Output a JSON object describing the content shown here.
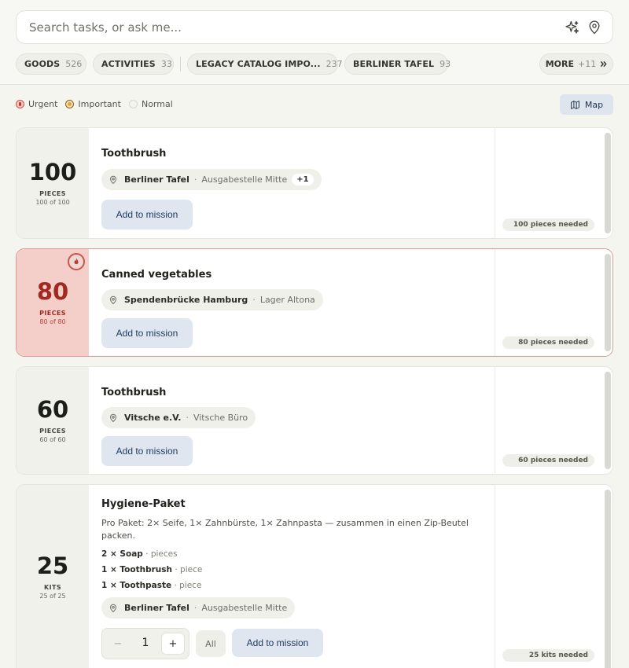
{
  "search": {
    "placeholder": "Search tasks, or ask me..."
  },
  "filters": [
    {
      "label": "GOODS",
      "count": "526"
    },
    {
      "label": "ACTIVITIES",
      "count": "33"
    },
    {
      "label": "LEGACY CATALOG IMPO...",
      "count": "237"
    },
    {
      "label": "BERLINER TAFEL",
      "count": "93"
    }
  ],
  "more": {
    "label": "MORE",
    "count": "+11"
  },
  "legend": {
    "urgent": "Urgent",
    "important": "Important",
    "normal": "Normal"
  },
  "map_button": "Map",
  "add_label": "Add to mission",
  "cards": [
    {
      "quantity": "100",
      "unit": "PIECES",
      "of": "100 of 100",
      "title": "Toothbrush",
      "org": "Berliner Tafel",
      "site": "Ausgabestelle Mitte",
      "extra": "+1",
      "needed": "100 pieces needed"
    },
    {
      "quantity": "80",
      "unit": "PIECES",
      "of": "80 of 80",
      "title": "Canned vegetables",
      "org": "Spendenbrücke Hamburg",
      "site": "Lager Altona",
      "needed": "80 pieces needed"
    },
    {
      "quantity": "60",
      "unit": "PIECES",
      "of": "60 of 60",
      "title": "Toothbrush",
      "org": "Vitsche e.V.",
      "site": "Vitsche Büro",
      "needed": "60 pieces needed"
    },
    {
      "quantity": "25",
      "unit": "KITS",
      "of": "25 of 25",
      "title": "Hygiene-Paket",
      "description": "Pro Paket: 2× Seife, 1× Zahnbürste, 1× Zahnpasta — zusammen in einen Zip-Beutel packen.",
      "components": [
        {
          "qty": "2 × Soap",
          "unit": "pieces"
        },
        {
          "qty": "1 × Toothbrush",
          "unit": "piece"
        },
        {
          "qty": "1 × Toothpaste",
          "unit": "piece"
        }
      ],
      "org": "Berliner Tafel",
      "site": "Ausgabestelle Mitte",
      "stepper_value": "1",
      "minus": "−",
      "plus": "+",
      "all_label": "All",
      "needed": "25 kits needed"
    }
  ],
  "colors": {
    "urgent_bg": "#f4cfca",
    "urgent_text": "#a12a20",
    "button_bg": "#dfe6ef",
    "button_text": "#1d3a5e"
  }
}
